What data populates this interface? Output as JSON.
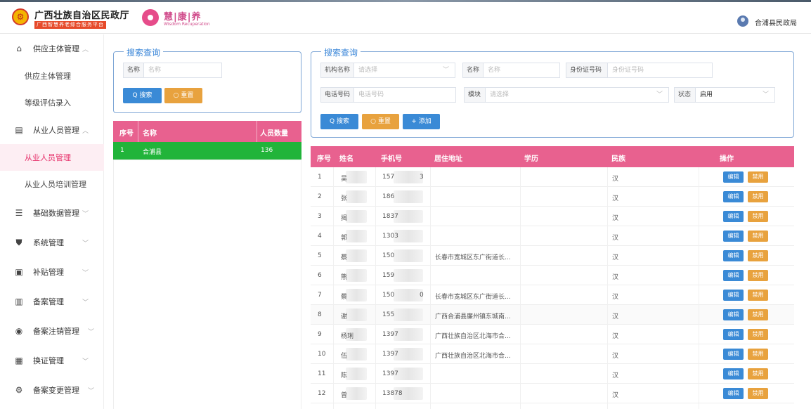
{
  "header": {
    "title": "广西壮族自治区民政厅",
    "subtitle": "广西智慧养老综合服务平台",
    "brand": "慧|康|养",
    "brand_sub": "Wisdom Recuperation",
    "user": "合浦县民政局"
  },
  "sidebar": {
    "items": [
      {
        "label": "供应主体管理",
        "icon": "bank-icon",
        "chevron": "^"
      },
      {
        "label": "供应主体管理"
      },
      {
        "label": "等级评估录入"
      },
      {
        "label": "从业人员管理",
        "icon": "id-card-icon",
        "chevron": "^"
      },
      {
        "label": "从业人员管理",
        "active": true
      },
      {
        "label": "从业人员培训管理"
      },
      {
        "label": "基础数据管理",
        "icon": "list-icon",
        "chevron": "v"
      },
      {
        "label": "系统管理",
        "icon": "shield-icon",
        "chevron": "v"
      },
      {
        "label": "补贴管理",
        "icon": "box-icon",
        "chevron": "v"
      },
      {
        "label": "备案管理",
        "icon": "building-icon",
        "chevron": "v"
      },
      {
        "label": "备案注销管理",
        "icon": "circle-icon",
        "chevron": "v"
      },
      {
        "label": "换证管理",
        "icon": "card-icon",
        "chevron": "v"
      },
      {
        "label": "备案变更管理",
        "icon": "user-gear-icon",
        "chevron": "v"
      }
    ]
  },
  "left_search": {
    "legend": "搜索查询",
    "name_label": "名称",
    "name_placeholder": "名称",
    "search_btn": "Q 搜索",
    "reset_btn": "○ 重置"
  },
  "left_table": {
    "headers": [
      "序号",
      "名称",
      "人员数量"
    ],
    "rows": [
      [
        "1",
        "合浦县",
        "136"
      ]
    ]
  },
  "right_search": {
    "legend": "搜索查询",
    "org_label": "机构名称",
    "org_placeholder": "请选择",
    "name_label": "名称",
    "name_placeholder": "名称",
    "id_label": "身份证号码",
    "id_placeholder": "身份证号码",
    "phone_label": "电话号码",
    "phone_placeholder": "电话号码",
    "module_label": "模块",
    "module_placeholder": "请选择",
    "status_label": "状态",
    "status_value": "启用",
    "search_btn": "Q 搜索",
    "reset_btn": "○ 重置",
    "add_btn": "+ 添加"
  },
  "main_table": {
    "headers": [
      "序号",
      "姓名",
      "手机号",
      "居住地址",
      "学历",
      "民族",
      "操作"
    ],
    "edit_label": "编辑",
    "ban_label": "禁用",
    "rows": [
      {
        "no": "1",
        "name": "吴",
        "phone": "157",
        "phone_tail": "3",
        "address": "",
        "edu": "",
        "ethnic": "汉"
      },
      {
        "no": "2",
        "name": "张",
        "phone": "186",
        "phone_tail": "",
        "address": "",
        "edu": "",
        "ethnic": "汉"
      },
      {
        "no": "3",
        "name": "揭",
        "phone": "1837",
        "phone_tail": "",
        "address": "",
        "edu": "",
        "ethnic": "汉"
      },
      {
        "no": "4",
        "name": "郭",
        "phone": "1303",
        "phone_tail": "",
        "address": "",
        "edu": "",
        "ethnic": "汉"
      },
      {
        "no": "5",
        "name": "蔡",
        "phone": "150",
        "phone_tail": "",
        "address": "长春市宽城区东广街道长...",
        "edu": "",
        "ethnic": "汉"
      },
      {
        "no": "6",
        "name": "熊",
        "phone": "159",
        "phone_tail": "",
        "address": "",
        "edu": "",
        "ethnic": "汉"
      },
      {
        "no": "7",
        "name": "蔡",
        "phone": "150",
        "phone_tail": "0",
        "address": "长春市宽城区东广街道长...",
        "edu": "",
        "ethnic": "汉"
      },
      {
        "no": "8",
        "name": "谢",
        "phone": "155",
        "phone_tail": "",
        "address": "广西合浦县廉州镇东城南...",
        "edu": "",
        "ethnic": "汉"
      },
      {
        "no": "9",
        "name": "杨琍",
        "phone": "1397",
        "phone_tail": "",
        "address": "广西壮族自治区北海市合...",
        "edu": "",
        "ethnic": "汉"
      },
      {
        "no": "10",
        "name": "伍",
        "phone": "1397",
        "phone_tail": "",
        "address": "广西壮族自治区北海市合...",
        "edu": "",
        "ethnic": "汉"
      },
      {
        "no": "11",
        "name": "陈",
        "phone": "1397",
        "phone_tail": "",
        "address": "",
        "edu": "",
        "ethnic": "汉"
      },
      {
        "no": "12",
        "name": "曾",
        "phone": "13878",
        "phone_tail": "",
        "address": "",
        "edu": "",
        "ethnic": "汉"
      }
    ]
  }
}
